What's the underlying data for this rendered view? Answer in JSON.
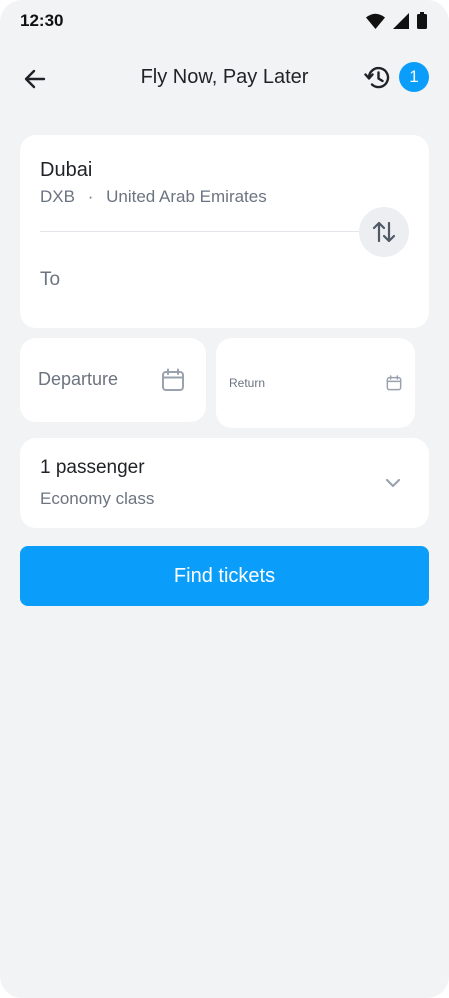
{
  "status_bar": {
    "time": "12:30"
  },
  "header": {
    "title": "Fly Now, Pay Later",
    "history_count": "1"
  },
  "route": {
    "origin_city": "Dubai",
    "origin_code": "DXB",
    "origin_separator": "·",
    "origin_country": "United Arab Emirates",
    "destination_placeholder": "To"
  },
  "dates": {
    "departure_label": "Departure",
    "return_label": "Return"
  },
  "passengers": {
    "count_label": "1 passenger",
    "class_label": "Economy class"
  },
  "actions": {
    "find_label": "Find tickets"
  },
  "colors": {
    "accent": "#0a9efa",
    "background": "#f2f3f5",
    "card": "#ffffff",
    "muted_text": "#6b7480"
  }
}
